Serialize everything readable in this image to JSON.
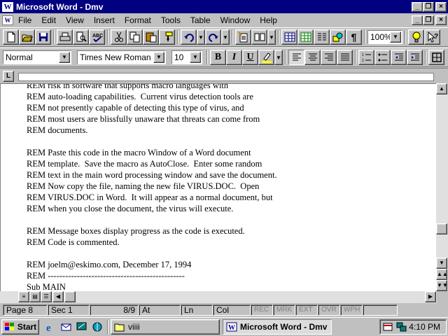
{
  "window": {
    "title": "Microsoft Word - Dmv",
    "app_icon": "W",
    "controls": [
      "_",
      "❐",
      "×"
    ]
  },
  "menubar": {
    "items": [
      "File",
      "Edit",
      "View",
      "Insert",
      "Format",
      "Tools",
      "Table",
      "Window",
      "Help"
    ],
    "doc_controls": [
      "_",
      "❐",
      "×"
    ]
  },
  "toolbar": {
    "zoom": "100%",
    "icons": [
      "new-icon",
      "open-icon",
      "save-icon",
      "print-icon",
      "print-preview-icon",
      "spelling-icon",
      "cut-icon",
      "copy-icon",
      "paste-icon",
      "format-painter-icon",
      "undo-icon",
      "redo-icon",
      "autotext-icon",
      "insert-table-icon",
      "columns-icon",
      "drawing-icon",
      "show-hide-icon",
      "tip-wizard-icon",
      "help-icon"
    ]
  },
  "formatting": {
    "style": "Normal",
    "font": "Times New Roman",
    "size": "10",
    "bold": "B",
    "italic": "I",
    "underline": "U"
  },
  "document": {
    "lines": [
      "REM risk in software that supports macro languages with",
      "REM auto-loading capabilities.  Current virus detection tools are",
      "REM not presently capable of detecting this type of virus, and",
      "REM most users are blissfully unaware that threats can come from",
      "REM documents.",
      "",
      "REM Paste this code in the macro Window of a Word document",
      "REM template.  Save the macro as AutoClose.  Enter some random",
      "REM text in the main word processing window and save the document.",
      "REM Now copy the file, naming the new file VIRUS.DOC.  Open",
      "REM VIRUS.DOC in Word.  It will appear as a normal document, but",
      "REM when you close the document, the virus will execute.",
      "",
      "REM Message boxes display progress as the code is executed.",
      "REM Code is commented.",
      "",
      "REM joelm@eskimo.com, December 17, 1994",
      "REM -----------------------------------------------",
      "Sub MAIN"
    ]
  },
  "status": {
    "page": "Page  8",
    "section": "Sec  1",
    "pages": "8/9",
    "at": "At",
    "ln": "Ln",
    "col": "Col",
    "modes": [
      "REC",
      "MRK",
      "EXT",
      "OVR",
      "WPH"
    ]
  },
  "taskbar": {
    "start": "Start",
    "tasks": [
      {
        "label": "viiii",
        "active": false
      },
      {
        "label": "Microsoft Word - Dmv",
        "active": true
      }
    ],
    "clock": "4:10 PM"
  }
}
